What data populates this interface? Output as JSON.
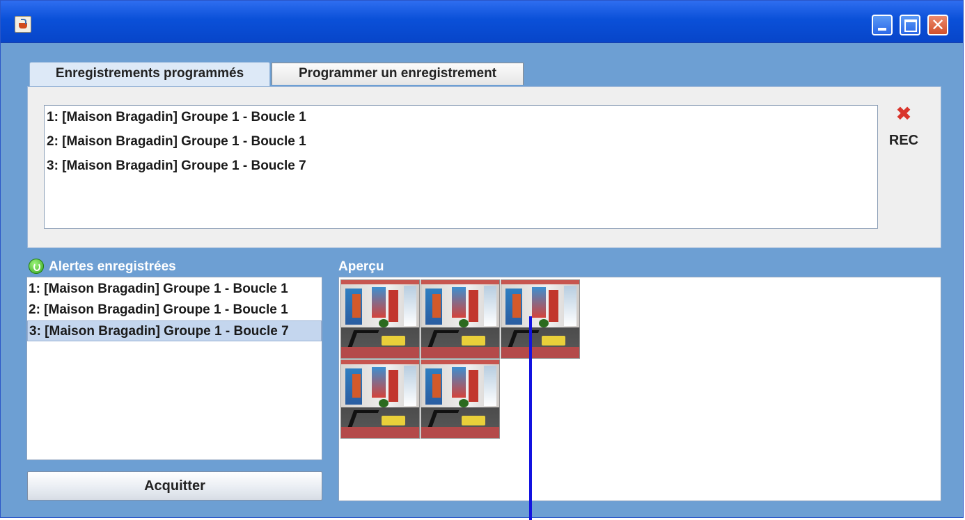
{
  "window": {
    "title": "",
    "controls": {
      "minimize": "minimize",
      "maximize": "maximize",
      "close": "close"
    }
  },
  "tabs": [
    {
      "label": "Enregistrements programmés",
      "active": true
    },
    {
      "label": "Programmer un enregistrement",
      "active": false
    }
  ],
  "scheduled": {
    "items": [
      "1: [Maison Bragadin] Groupe 1 - Boucle 1",
      "2: [Maison Bragadin] Groupe 1 - Boucle 1",
      "3: [Maison Bragadin] Groupe 1 - Boucle 7"
    ],
    "rec_label": "REC"
  },
  "alerts": {
    "title": "Alertes enregistrées",
    "items": [
      "1: [Maison Bragadin] Groupe 1 - Boucle 1",
      "2: [Maison Bragadin] Groupe 1 - Boucle 1",
      "3: [Maison Bragadin] Groupe 1 - Boucle 7"
    ],
    "selected_index": 2,
    "ack_button": "Acquitter"
  },
  "preview": {
    "title": "Aperçu",
    "thumbnail_count": 5
  },
  "colors": {
    "window_bg": "#6d9fd3",
    "titlebar": "#0a50d8",
    "selection": "#c4d6ee",
    "delete_icon": "#d9342b",
    "overlay_line": "#1313e0"
  }
}
